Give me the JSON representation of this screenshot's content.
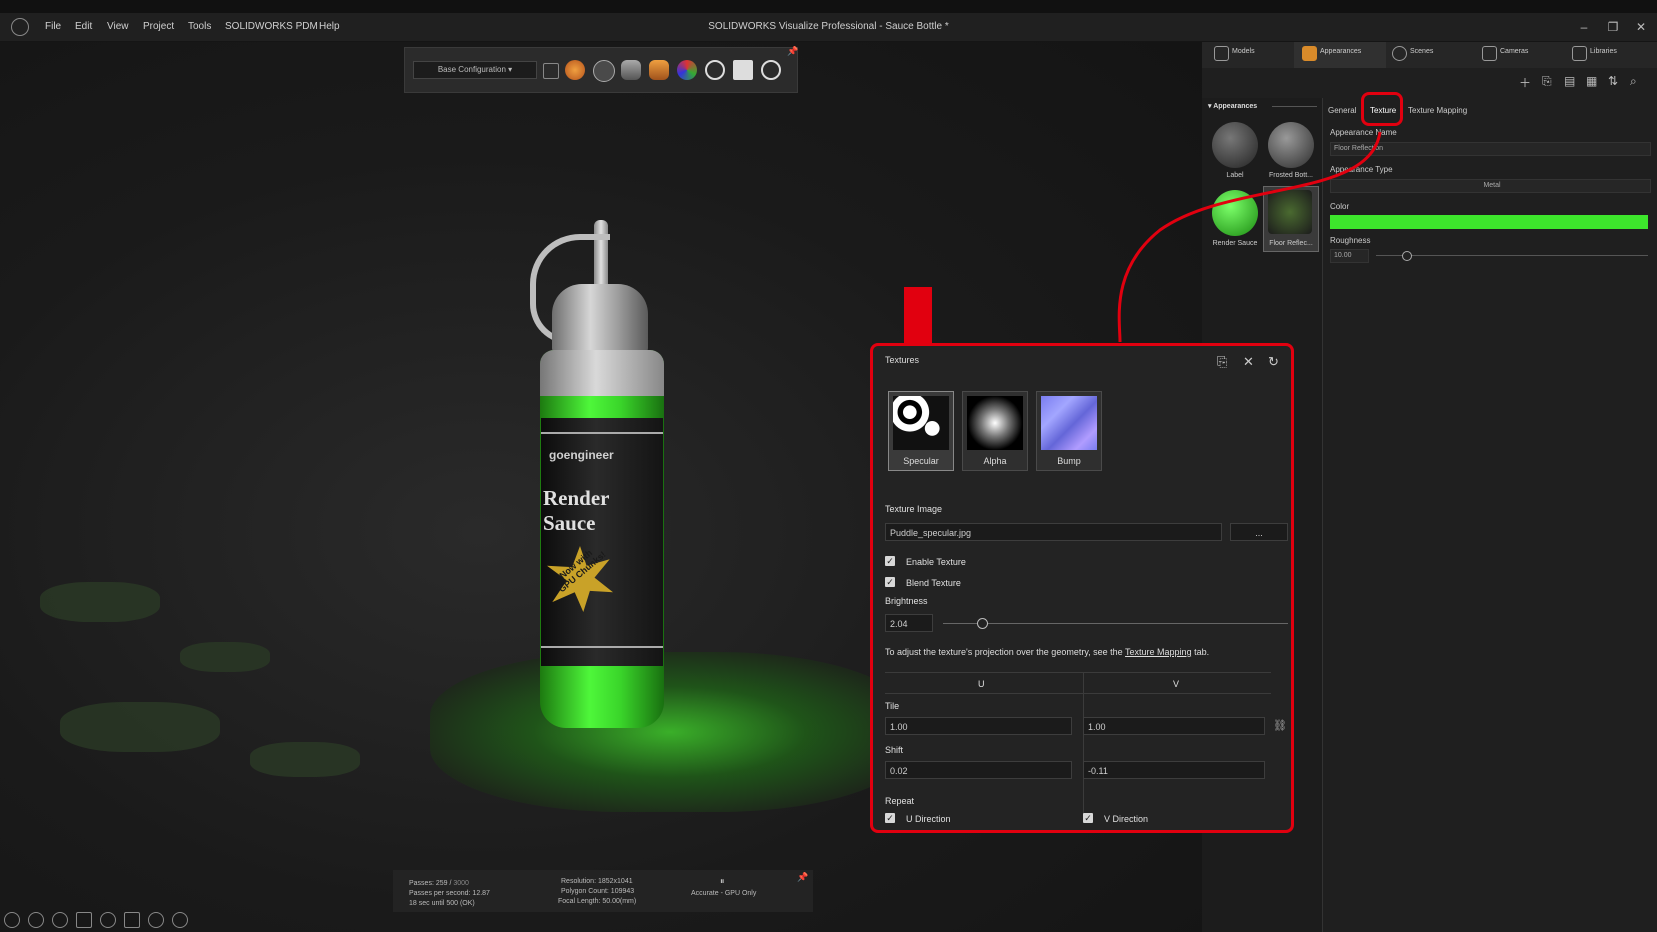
{
  "window": {
    "title": "SOLIDWORKS Visualize Professional - Sauce Bottle *",
    "menu": [
      "File",
      "Edit",
      "View",
      "Project",
      "Tools",
      "SOLIDWORKS PDM",
      "Help"
    ]
  },
  "toolbar": {
    "configuration": "Base Configuration"
  },
  "bottle": {
    "brand": "goengineer",
    "product": "Render Sauce",
    "badge": "Now with GPU Chunks!"
  },
  "palette": {
    "tabs": [
      "Models",
      "Appearances",
      "Scenes",
      "Cameras",
      "Libraries"
    ],
    "library_header": "Appearances",
    "library_items": [
      "Label",
      "Frosted Bott...",
      "Render Sauce",
      "Floor Reflec..."
    ],
    "subtabs": [
      "General",
      "Texture",
      "Texture Mapping"
    ],
    "fields": {
      "appearance_name_label": "Appearance Name",
      "appearance_name_value": "Floor Reflection",
      "appearance_type_label": "Appearance Type",
      "appearance_type_value": "Metal",
      "color_label": "Color",
      "color_value": "#3de62c",
      "roughness_label": "Roughness",
      "roughness_value": "10.00"
    }
  },
  "textures": {
    "title": "Textures",
    "maps": [
      "Specular",
      "Alpha",
      "Bump"
    ],
    "texture_image_label": "Texture Image",
    "texture_image_value": "Puddle_specular.jpg",
    "browse_label": "...",
    "enable_texture": "Enable Texture",
    "blend_texture": "Blend Texture",
    "brightness_label": "Brightness",
    "brightness_value": "2.04",
    "hint_prefix": "To adjust the texture's projection over the geometry, see the",
    "hint_link": "Texture Mapping",
    "hint_suffix": "tab.",
    "col_u": "U",
    "col_v": "V",
    "tile_label": "Tile",
    "tile_u": "1.00",
    "tile_v": "1.00",
    "shift_label": "Shift",
    "shift_u": "0.02",
    "shift_v": "-0.11",
    "repeat_label": "Repeat",
    "u_direction": "U Direction",
    "v_direction": "V Direction"
  },
  "status": {
    "passes_prefix": "Passes: 259 /",
    "passes_total": "3000",
    "passes_per_second": "Passes per second: 12.87",
    "elapsed": "18 sec until 500 (OK)",
    "resolution": "Resolution: 1852x1041",
    "polygon_count": "Polygon Count: 109943",
    "focal_length": "Focal Length: 50.00(mm)",
    "render_mode": "Accurate - GPU Only"
  },
  "accent_color": "#e1000f"
}
